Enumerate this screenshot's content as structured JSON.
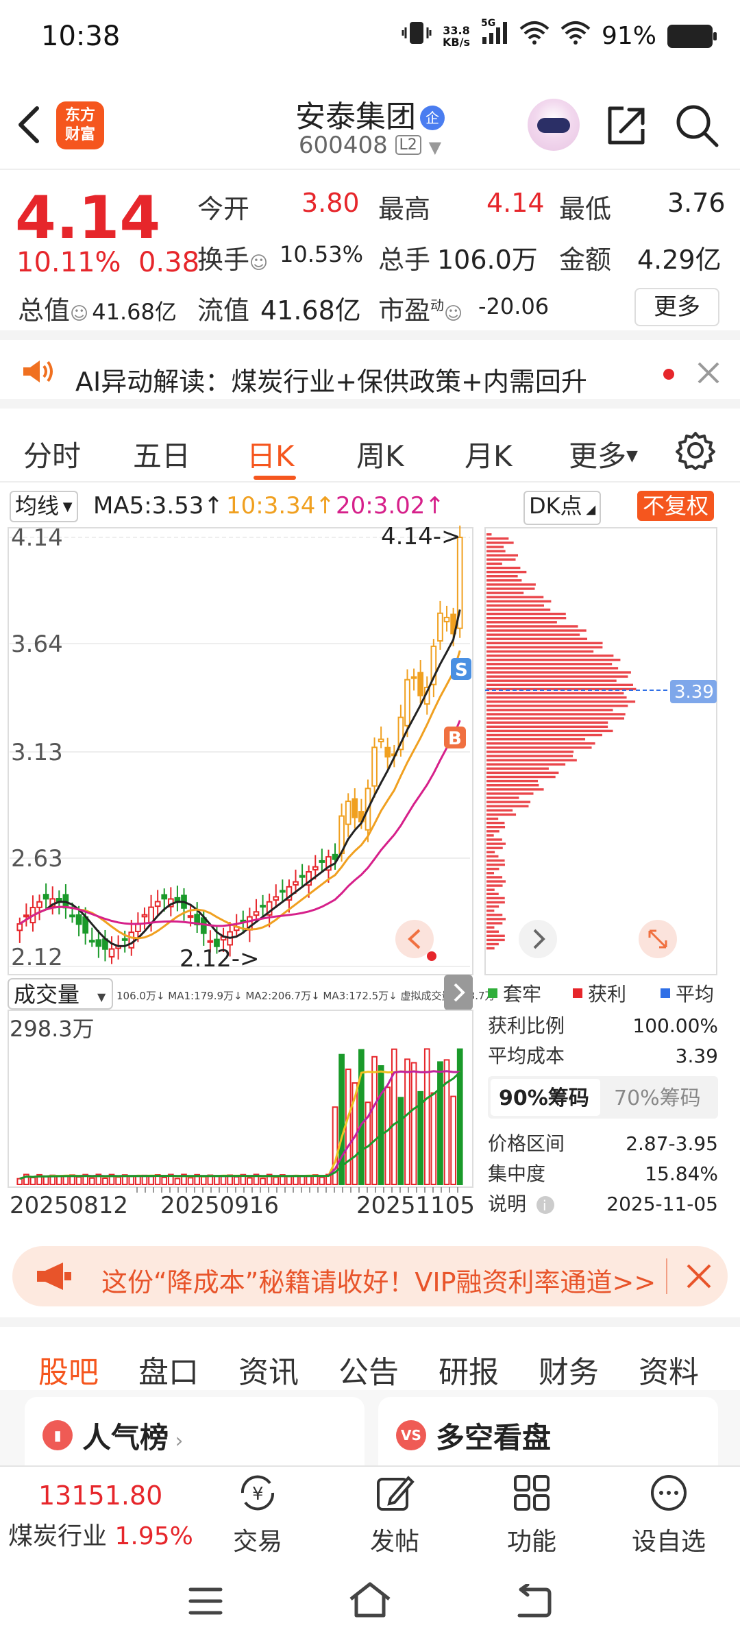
{
  "status_bar": {
    "time": "10:38",
    "net_speed_value": "33.8",
    "net_speed_unit": "KB/s",
    "network": "5G",
    "battery": "91%"
  },
  "header": {
    "logo_line1": "东方",
    "logo_line2": "财富",
    "stock_name": "安泰集团",
    "badge": "企",
    "stock_code": "600408",
    "level": "L2"
  },
  "quote": {
    "price": "4.14",
    "change_pct": "10.11%",
    "change": "0.38",
    "open_label": "今开",
    "open": "3.80",
    "high_label": "最高",
    "high": "4.14",
    "low_label": "最低",
    "low": "3.76",
    "turnover_label": "换手",
    "turnover": "10.53%",
    "volume_label": "总手",
    "volume": "106.0万",
    "amount_label": "金额",
    "amount": "4.29亿",
    "total_mv_label": "总值",
    "total_mv": "41.68亿",
    "float_mv_label": "流值",
    "float_mv": "41.68亿",
    "pe_label": "市盈",
    "pe_sup": "动",
    "pe": "-20.06",
    "more": "更多"
  },
  "ai_banner": {
    "text": "AI异动解读：煤炭行业+保供政策+内需回升"
  },
  "tabs": [
    "分时",
    "五日",
    "日K",
    "周K",
    "月K",
    "更多"
  ],
  "ma_row": {
    "selector": "均线",
    "ma5": "MA5:3.53",
    "ma10": "10:3.34",
    "ma20": "20:3.02",
    "dk": "DK点",
    "fuquan": "不复权"
  },
  "chart_data": [
    {
      "type": "candlestick",
      "y_ticks": [
        "4.14",
        "3.64",
        "3.13",
        "2.63",
        "2.12"
      ],
      "ylim": [
        2.12,
        4.14
      ],
      "high_marker": "4.14->",
      "low_marker": "2.12->",
      "signals": [
        "S",
        "B"
      ],
      "series": [
        {
          "name": "MA5",
          "last": 3.53,
          "color": "#222222"
        },
        {
          "name": "MA10",
          "last": 3.34,
          "color": "#f0a020"
        },
        {
          "name": "MA20",
          "last": 3.02,
          "color": "#d6208a"
        }
      ]
    },
    {
      "type": "bar",
      "title": "成交量",
      "indicator_text": "106.0万↓ MA1:179.9万↓ MA2:206.7万↓ MA3:172.5万↓ 虚拟成交量:193.7万",
      "ymax_label": "298.3万",
      "x_ticks": [
        "20250812",
        "20250916",
        "20251105"
      ]
    },
    {
      "type": "bar",
      "title": "chip-distribution",
      "avg_cost": "3.39"
    }
  ],
  "chip_panel": {
    "legend": [
      "套牢",
      "获利",
      "平均"
    ],
    "legend_colors": [
      "#2fae3a",
      "#e6262b",
      "#2f6fe6"
    ],
    "profit_ratio_label": "获利比例",
    "profit_ratio": "100.00%",
    "avg_cost_label": "平均成本",
    "avg_cost": "3.39",
    "tab_90": "90%筹码",
    "tab_70": "70%筹码",
    "price_range_label": "价格区间",
    "price_range": "2.87-3.95",
    "concentration_label": "集中度",
    "concentration": "15.84%",
    "note_label": "说明",
    "note_date": "2025-11-05"
  },
  "ad": {
    "text": "这份“降成本”秘籍请收好！VIP融资利率通道>>"
  },
  "bottom_tabs": [
    "股吧",
    "盘口",
    "资讯",
    "公告",
    "研报",
    "财务",
    "资料"
  ],
  "cards": [
    {
      "title": "人气榜"
    },
    {
      "title": "多空看盘",
      "icon": "VS"
    }
  ],
  "toolbar": {
    "index_value": "13151.80",
    "index_name": "煤炭行业",
    "index_change": "1.95%",
    "items": [
      "交易",
      "发帖",
      "功能",
      "设自选"
    ]
  }
}
